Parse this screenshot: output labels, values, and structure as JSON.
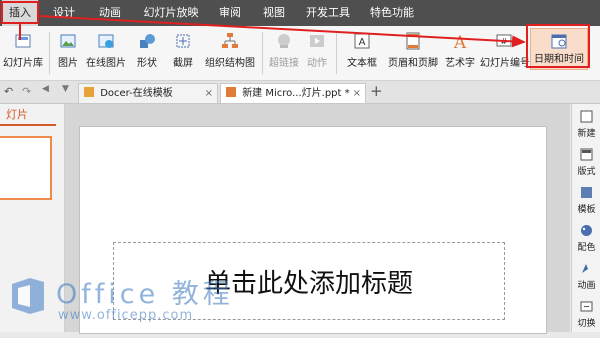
{
  "menu": {
    "tabs": [
      {
        "label": "插入"
      },
      {
        "label": "设计"
      },
      {
        "label": "动画"
      },
      {
        "label": "幻灯片放映"
      },
      {
        "label": "审阅"
      },
      {
        "label": "视图"
      },
      {
        "label": "开发工具"
      },
      {
        "label": "特色功能"
      }
    ]
  },
  "ribbon": {
    "slide_library": "幻灯片库",
    "picture": "图片",
    "online_picture": "在线图片",
    "shapes": "形状",
    "screenshot": "截屏",
    "org_chart": "组织结构图",
    "hyperlink": "超链接",
    "action": "动作",
    "textbox": "文本框",
    "header_footer": "页眉和页脚",
    "wordart": "艺术字",
    "slide_number": "幻灯片编号",
    "date_time": "日期和时间"
  },
  "doc_tabs": {
    "docer": "Docer-在线模板",
    "new_doc": "新建 Micro...灯片.ppt *"
  },
  "left_panel": {
    "slides_tab": "灯片"
  },
  "slide": {
    "title_placeholder": "单击此处添加标题"
  },
  "right_panel": {
    "items": [
      {
        "label": "新建"
      },
      {
        "label": "版式"
      },
      {
        "label": "模板"
      },
      {
        "label": "配色"
      },
      {
        "label": "动画"
      },
      {
        "label": "切换"
      }
    ]
  },
  "watermark": {
    "brand": "Office 教程",
    "url": "www.officepp.com"
  },
  "colors": {
    "accent": "#d45b2a",
    "highlight_border": "#e02020"
  }
}
